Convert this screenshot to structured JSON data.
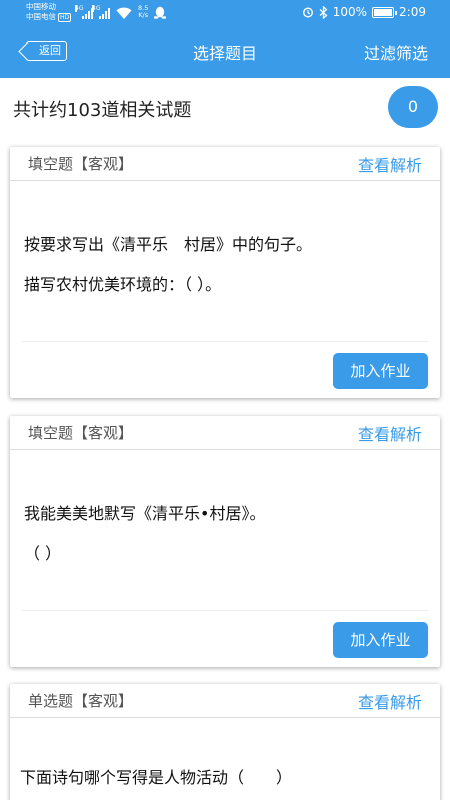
{
  "status_bar": {
    "carrier1": "中国移动",
    "carrier2": "中国电信",
    "hd": "HD",
    "net1": "4G",
    "net2": "4G",
    "speed_value": "8.5",
    "speed_unit": "K/s",
    "battery": "100%",
    "time": "2:09"
  },
  "nav": {
    "back_label": "返回",
    "title": "选择题目",
    "filter_label": "过滤筛选"
  },
  "summary": {
    "text": "共计约103道相关试题",
    "count": "0"
  },
  "questions": [
    {
      "type": "填空题【客观】",
      "view_label": "查看解析",
      "lines": [
        "按要求写出《清平乐　村居》中的句子。",
        "描写农村优美环境的：（ ）。"
      ],
      "add_label": "加入作业"
    },
    {
      "type": "填空题【客观】",
      "view_label": "查看解析",
      "lines": [
        "我能美美地默写《清平乐•村居》。",
        "（ ）"
      ],
      "add_label": "加入作业"
    },
    {
      "type": "单选题【客观】",
      "view_label": "查看解析",
      "lines": [
        "下面诗句哪个写得是人物活动（　　）"
      ]
    }
  ]
}
